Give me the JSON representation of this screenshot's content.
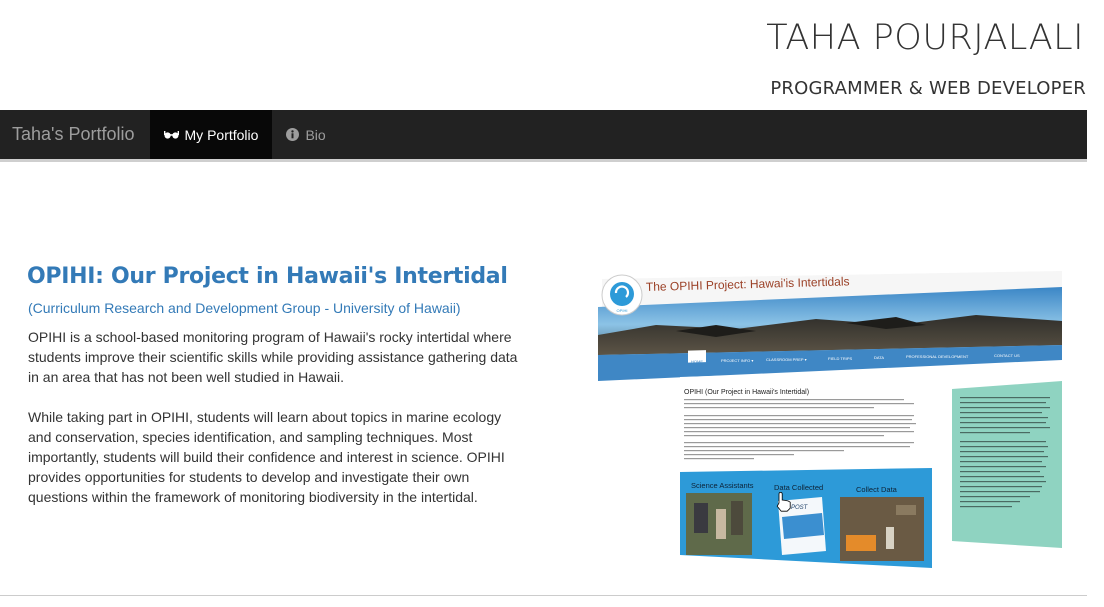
{
  "header": {
    "name": "TAHA POURJALALI",
    "role": "PROGRAMMER & WEB DEVELOPER"
  },
  "navbar": {
    "brand": "Taha's Portfolio",
    "items": [
      {
        "label": "My Portfolio",
        "icon": "glasses-icon",
        "active": true
      },
      {
        "label": "Bio",
        "icon": "info-circle-icon",
        "active": false
      }
    ]
  },
  "project": {
    "title": "OPIHI: Our Project in Hawaii's Intertidal",
    "organization": "(Curriculum Research and Development Group - University of Hawaii)",
    "paragraphs": [
      "OPIHI is a school-based monitoring program of Hawaii's rocky intertidal where students improve their scientific skills while providing assistance gathering data in an area that has not been well studied in Hawaii.",
      "While taking part in OPIHI, students will learn about topics in marine ecology and conservation, species identification, and sampling techniques. Most importantly, students will build their confidence and interest in science. OPIHI provides opportunities for students to develop and investigate their own questions within the framework of monitoring biodiversity in the intertidal."
    ]
  },
  "screenshot": {
    "site_title": "The OPIHI Project: Hawai'is Intertidals",
    "logo_text": "OPIHI",
    "menu": [
      "HOME",
      "PROJECT INFO ▾",
      "CLASSROOM PREP ▾",
      "FIELD TRIPS",
      "DATA",
      "PROFESSIONAL DEVELOPMENT",
      "CONTACT US"
    ],
    "heading": "OPIHI (Our Project in Hawaii's Intertidal)",
    "cards": [
      "Science Assistants",
      "Data Collected",
      "Collect Data"
    ],
    "card_badge": "POST"
  },
  "colors": {
    "navbar_bg": "#222222",
    "navbar_active_bg": "#080808",
    "link_blue": "#337ab7",
    "site_blue": "#2d9ad8",
    "sidebar_green": "#8fd3c1"
  }
}
